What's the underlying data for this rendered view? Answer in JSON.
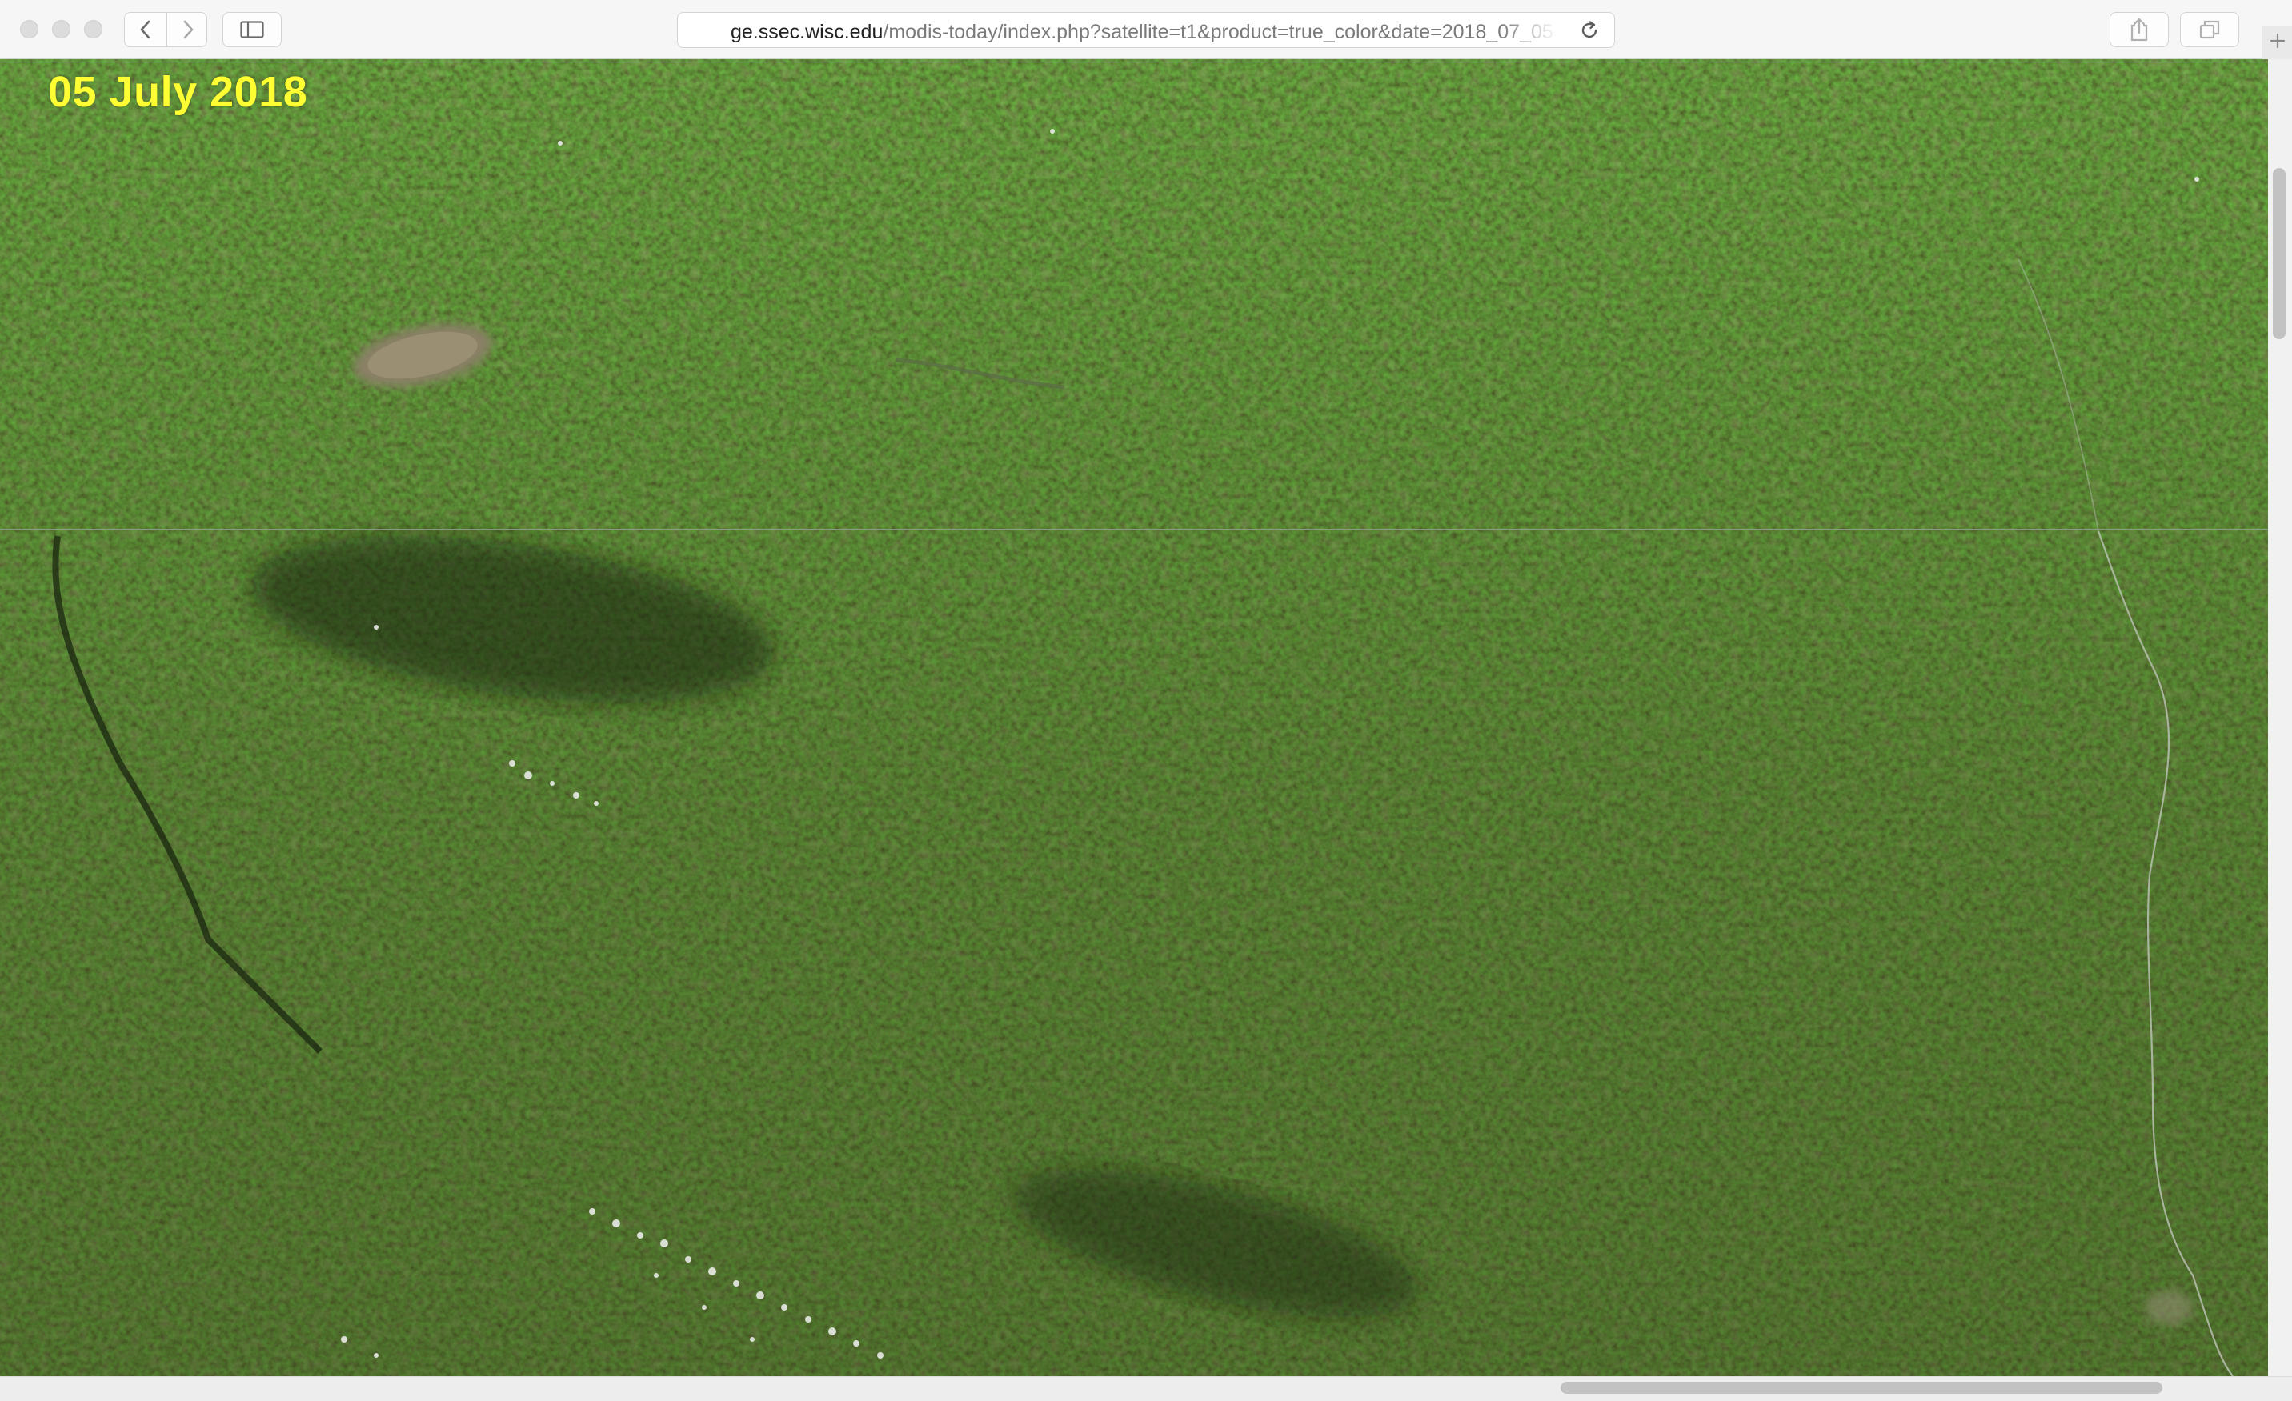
{
  "browser": {
    "url_host": "ge.ssec.wisc.edu",
    "url_path": "/modis-today/index.php?satellite=t1&product=true_color&date=2018_07_05",
    "icons": {
      "back": "chevron-left-icon",
      "forward": "chevron-right-icon",
      "sidebar": "sidebar-icon",
      "reload": "reload-icon",
      "share": "share-icon",
      "tabs": "tabs-icon",
      "new_tab": "plus-icon"
    }
  },
  "page": {
    "date_label": "05 July 2018",
    "date_label_color": "#ffff33"
  }
}
